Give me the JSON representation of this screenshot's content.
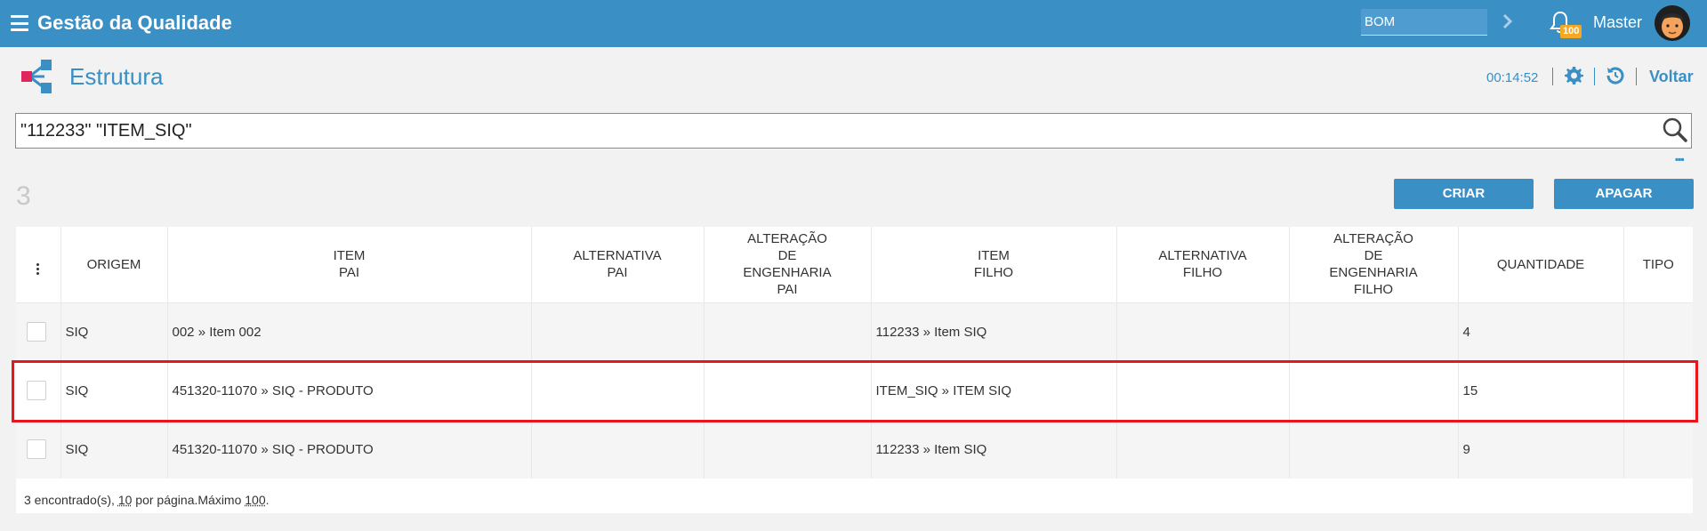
{
  "app": {
    "title": "Gestão da Qualidade",
    "module_value": "BOM",
    "notification_count": "100",
    "user_name": "Master"
  },
  "page": {
    "title": "Estrutura",
    "timer": "00:14:52",
    "back_label": "Voltar"
  },
  "search": {
    "value": "\"112233\" \"ITEM_SIQ\""
  },
  "results": {
    "count": "3",
    "create_label": "CRIAR",
    "delete_label": "APAGAR"
  },
  "table": {
    "columns": [
      "ORIGEM",
      "ITEM\nPAI",
      "ALTERNATIVA\nPAI",
      "ALTERAÇÃO\nDE\nENGENHARIA\nPAI",
      "ITEM\nFILHO",
      "ALTERNATIVA\nFILHO",
      "ALTERAÇÃO\nDE\nENGENHARIA\nFILHO",
      "QUANTIDADE",
      "TIPO"
    ],
    "rows": [
      {
        "origem": "SIQ",
        "item_pai": "002 » Item 002",
        "alt_pai": "",
        "eng_pai": "",
        "item_filho": "112233 » Item SIQ",
        "alt_filho": "",
        "eng_filho": "",
        "quantidade": "4",
        "tipo": ""
      },
      {
        "origem": "SIQ",
        "item_pai": "451320-11070 » SIQ - PRODUTO",
        "alt_pai": "",
        "eng_pai": "",
        "item_filho": "ITEM_SIQ » ITEM SIQ",
        "alt_filho": "",
        "eng_filho": "",
        "quantidade": "15",
        "tipo": ""
      },
      {
        "origem": "SIQ",
        "item_pai": "451320-11070 » SIQ - PRODUTO",
        "alt_pai": "",
        "eng_pai": "",
        "item_filho": "112233 » Item SIQ",
        "alt_filho": "",
        "eng_filho": "",
        "quantidade": "9",
        "tipo": ""
      }
    ]
  },
  "footer": {
    "prefix": "3 encontrado(s), ",
    "per_page": "10",
    "middle": " por página.Máximo ",
    "max": "100",
    "suffix": "."
  },
  "colors": {
    "accent": "#3a8fc4",
    "badge": "#f7a823",
    "highlight": "#e8161a"
  }
}
